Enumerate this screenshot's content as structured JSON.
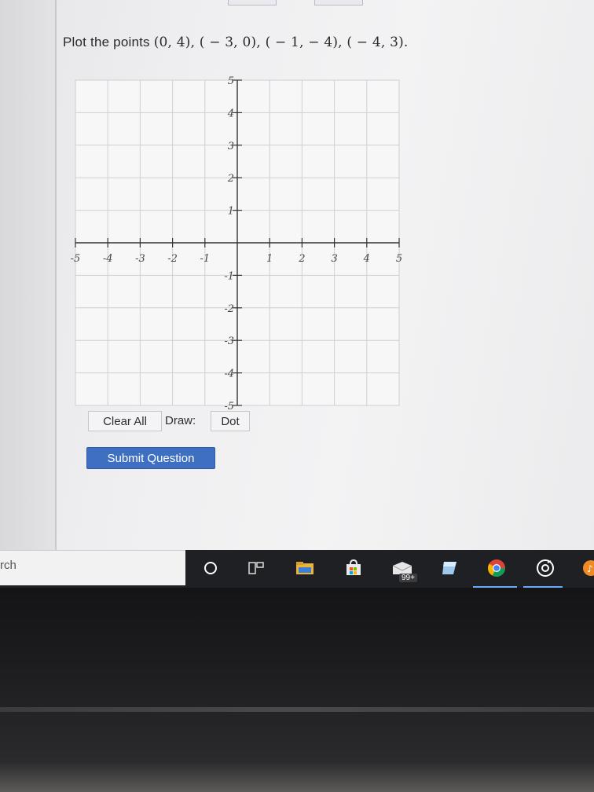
{
  "question": {
    "prefix": "Plot the points",
    "points_text": "(0, 4), ( − 3, 0), ( − 1,  − 4), ( − 4, 3)."
  },
  "graph": {
    "x_ticks": [
      "-5",
      "-4",
      "-3",
      "-2",
      "-1",
      "1",
      "2",
      "3",
      "4",
      "5"
    ],
    "y_ticks": [
      "5",
      "4",
      "3",
      "2",
      "1",
      "-1",
      "-2",
      "-3",
      "-4",
      "-5"
    ],
    "x_range": [
      -5,
      5
    ],
    "y_range": [
      -5,
      5
    ],
    "grid": true
  },
  "toolbar": {
    "clear_all_label": "Clear All",
    "draw_label": "Draw:",
    "dot_label": "Dot"
  },
  "submit": {
    "label": "Submit Question"
  },
  "taskbar": {
    "search_text": "rch",
    "badge": "99+",
    "icons": [
      "cortana-circle-icon",
      "task-view-icon",
      "file-explorer-icon",
      "store-icon",
      "mail-icon",
      "app-icon",
      "chrome-icon",
      "media-icon",
      "music-icon"
    ]
  },
  "colors": {
    "submit_bg": "#3f6fc0",
    "grid_line": "#cfcfd4",
    "axis_line": "#333333"
  }
}
